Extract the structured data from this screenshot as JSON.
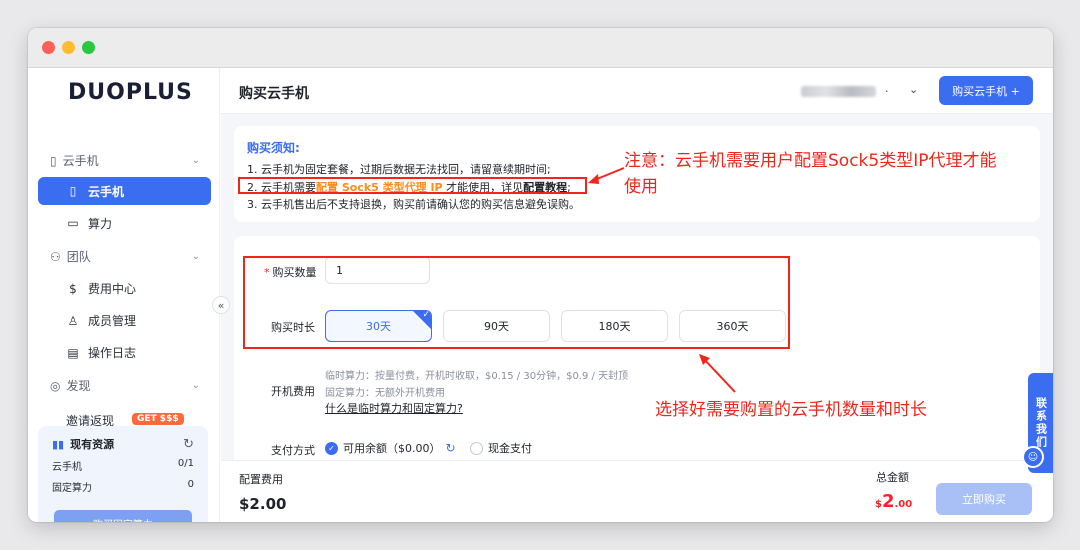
{
  "sidebar": {
    "logo": "DUOPLUS",
    "groups": [
      {
        "label": "云手机"
      },
      {
        "label": "团队"
      },
      {
        "label": "发现"
      }
    ],
    "items": {
      "cloud_phone": "云手机",
      "compute": "算力",
      "billing": "费用中心",
      "members": "成员管理",
      "logs": "操作日志",
      "hidden_item": "邀请返现"
    },
    "get_badge": "GET $$$",
    "resources": {
      "title": "现有资源",
      "rows": [
        {
          "label": "云手机",
          "value": "0/1"
        },
        {
          "label": "固定算力",
          "value": "0"
        }
      ],
      "button": "购买固定算力"
    }
  },
  "header": {
    "title": "购买云手机",
    "buy_button": "购买云手机 +"
  },
  "notice": {
    "title": "购买须知:",
    "line1": "1. 云手机为固定套餐，过期后数据无法找回，请留意续期时间;",
    "line2_prefix": "2. 云手机需要",
    "line2_highlight": "配置 Sock5 类型代理 IP",
    "line2_middle": " 才能使用，详见",
    "line2_link": "配置教程",
    "line2_suffix": ";",
    "line3": "3. 云手机售出后不支持退换，购买前请确认您的购买信息避免误购。"
  },
  "form": {
    "qty_label": "购买数量",
    "qty_value": "1",
    "duration_label": "购买时长",
    "durations": [
      "30天",
      "90天",
      "180天",
      "360天"
    ],
    "selected_duration": "30天",
    "fee_label": "开机费用",
    "fee_line1": "临时算力：按量付费，开机时收取，$0.15 / 30分钟，$0.9 / 天封顶",
    "fee_line2": "固定算力：无额外开机费用",
    "fee_link": "什么是临时算力和固定算力?",
    "payment_label": "支付方式",
    "payment_balance": "可用余额（$0.00）",
    "payment_cash": "现金支付"
  },
  "footer": {
    "config_label": "配置费用",
    "config_value": "$2.00",
    "total_label": "总金额",
    "total_currency": "$",
    "total_int": "2",
    "total_dec": ".00",
    "buy_now": "立即购买"
  },
  "contact": "联系我们",
  "annotations": {
    "note1": "注意：云手机需要用户配置Sock5类型IP代理才能",
    "note1_line2": "使用",
    "note2": "选择好需要购置的云手机数量和时长"
  },
  "colors": {
    "accent": "#3a6df0",
    "highlight": "#ff8c1a",
    "annotation": "#f0261c"
  }
}
